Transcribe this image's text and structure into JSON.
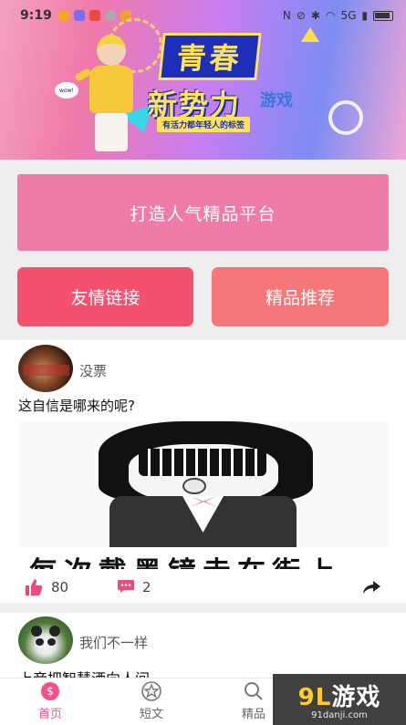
{
  "status_bar": {
    "time": "9:19",
    "right_text": "5G"
  },
  "banner": {
    "title_line1": "青春",
    "title_line2": "新势力",
    "slogan": "有活力都年轻人的标签",
    "watermark": "游戏",
    "sign_text": "wow!"
  },
  "buttons": {
    "main": "打造人气精品平台",
    "left": "友情链接",
    "right": "精品推荐"
  },
  "posts": [
    {
      "username": "没票",
      "text": "这自信是哪来的呢?",
      "image_caption": "每次戴墨镜走在街上",
      "likes": "80",
      "comments": "2"
    },
    {
      "username": "我们不一样",
      "text": "上帝把智慧洒向人间"
    }
  ],
  "tabbar": {
    "items": [
      {
        "label": "首页",
        "active": true
      },
      {
        "label": "短文",
        "active": false
      },
      {
        "label": "精品",
        "active": false
      }
    ]
  },
  "watermark": {
    "logo_num": "9L",
    "logo_text": "游戏",
    "url": "91danji.com"
  },
  "colors": {
    "accent_pink": "#ef7ca8",
    "button_red": "#f3516e",
    "button_coral": "#f6777a",
    "active_tab": "#f4508b",
    "like_icon": "#e94d7c"
  }
}
